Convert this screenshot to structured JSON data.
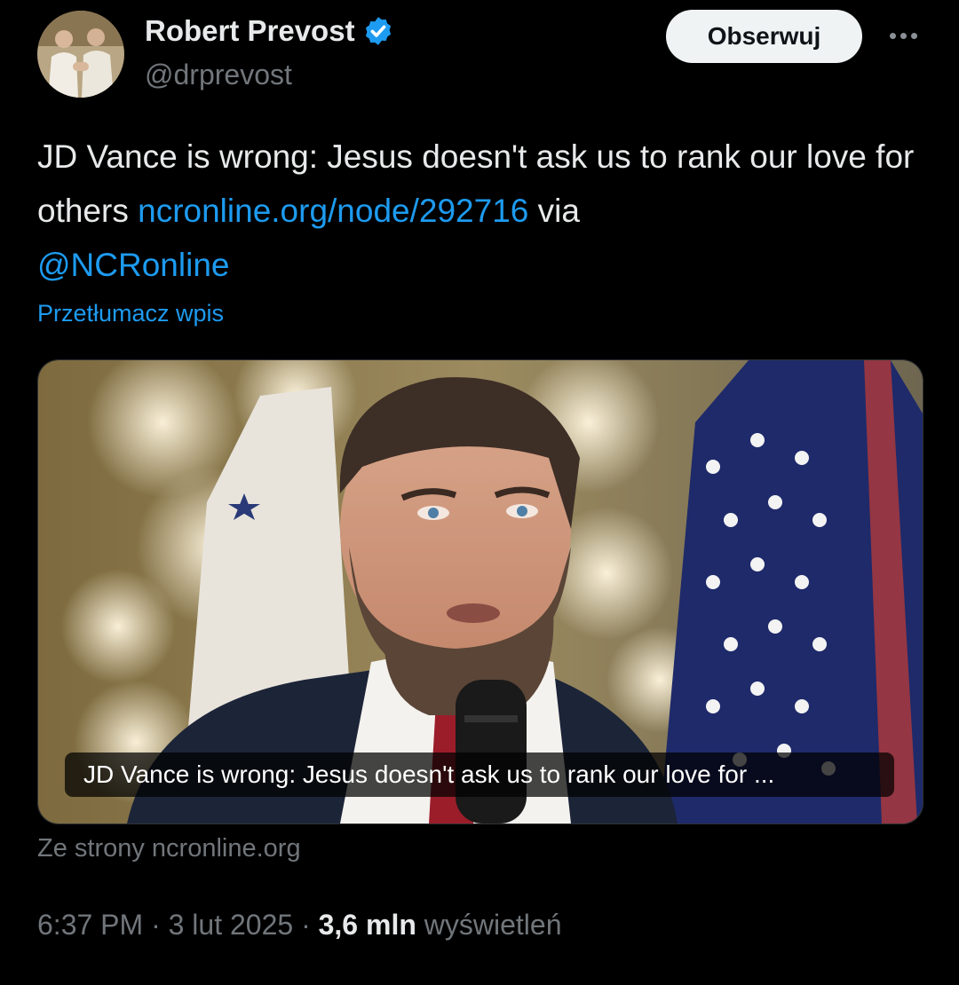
{
  "author": {
    "name": "Robert Prevost",
    "handle": "@drprevost",
    "verified": true,
    "verified_color": "#1d9bf0"
  },
  "follow_button": {
    "label": "Obserwuj"
  },
  "more_button": {
    "icon": "more-horizontal-icon"
  },
  "tweet": {
    "text_before_link": "JD Vance is wrong: Jesus doesn't ask us to rank our love for others",
    "link_text": "ncronline.org/node/292716",
    "text_via": "via",
    "mention": "@NCRonline",
    "translate_label": "Przetłumacz wpis"
  },
  "link_card": {
    "title": "JD Vance is wrong: Jesus doesn't ask us to rank our love for ...",
    "source": "Ze strony ncronline.org"
  },
  "meta": {
    "time": "6:37 PM",
    "date": "3 lut 2025",
    "separator": "·",
    "views_count": "3,6 mln",
    "views_label": "wyświetleń"
  },
  "colors": {
    "background": "#000000",
    "text": "#e7e9ea",
    "secondary": "#71767b",
    "link": "#1d9bf0"
  }
}
